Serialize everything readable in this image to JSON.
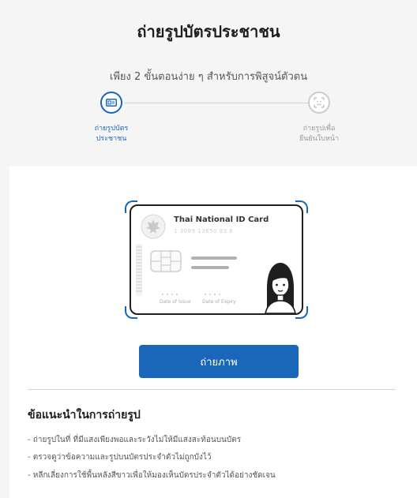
{
  "header": {
    "title": "ถ่ายรูปบัตรประชาชน",
    "subtitle": "เพียง 2 ขั้นตอนง่าย ๆ สำหรับการพิสูจน์ตัวตน"
  },
  "steps": [
    {
      "label_line1": "ถ่ายรูปบัตร",
      "label_line2": "ประชาชน",
      "icon": "id-card-icon",
      "active": true
    },
    {
      "label_line1": "ถ่ายรูปเพื่อ",
      "label_line2": "ยืนยันใบหน้า",
      "icon": "face-scan-icon",
      "active": false
    }
  ],
  "id_card": {
    "title": "Thai National ID Card",
    "number": "1 3099 13650 93 6",
    "date_of_issue_label": "Date of Issue",
    "date_of_expiry_label": "Date of Expiry",
    "emblem_icon": "garuda-emblem-icon",
    "chip_icon": "chip-icon",
    "portrait_icon": "portrait-icon"
  },
  "actions": {
    "capture_label": "ถ่ายภาพ"
  },
  "tips": {
    "title": "ข้อแนะนำในการถ่ายรูป",
    "items": [
      "- ถ่ายรูปในที่ ที่มีแสงเพียงพอและระวังไม่ให้มีแสงสะท้อนบนบัตร",
      "- ตรวจดูว่าข้อความและรูปบนบัตรประจำตัวไม่ถูกบังไว้",
      "- หลีกเลี่ยงการใช้พื้นหลังสีขาวเพื่อให้มองเห็นบัตรประจำตัวได้อย่างชัดเจน"
    ]
  },
  "colors": {
    "primary": "#1a66b8",
    "inactive": "#c9ccd1",
    "background": "#f5f5f6"
  }
}
